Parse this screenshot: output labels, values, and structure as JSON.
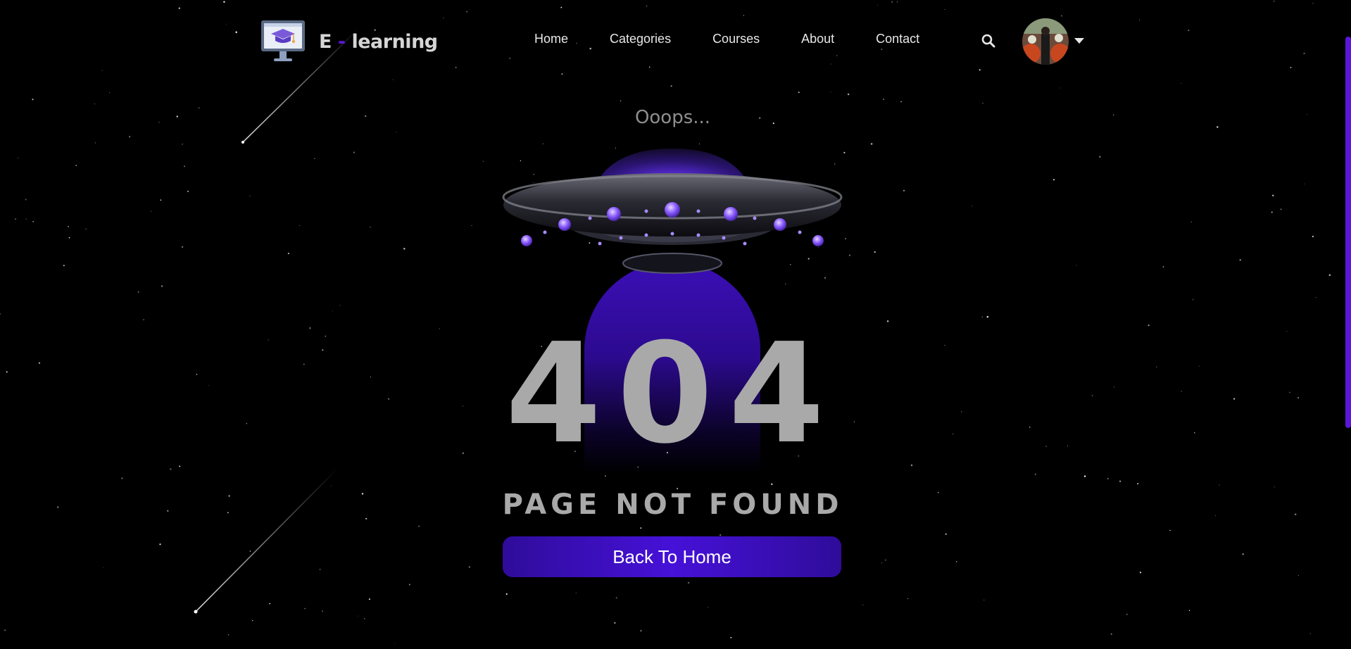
{
  "brand": {
    "logo_icon": "graduation-cap-monitor-icon",
    "name_prefix": "E",
    "name_dash": "-",
    "name_suffix": "learning"
  },
  "nav": {
    "items": [
      "Home",
      "Categories",
      "Courses",
      "About",
      "Contact"
    ]
  },
  "header_icons": {
    "search": "search-icon",
    "user_menu": "chevron-down-icon"
  },
  "error": {
    "oops": "Ooops...",
    "code": "404",
    "title": "PAGE NOT FOUND",
    "button_label": "Back To Home"
  },
  "colors": {
    "accent": "#5a17d6",
    "background": "#000000",
    "text_muted": "#a9a9a9"
  }
}
